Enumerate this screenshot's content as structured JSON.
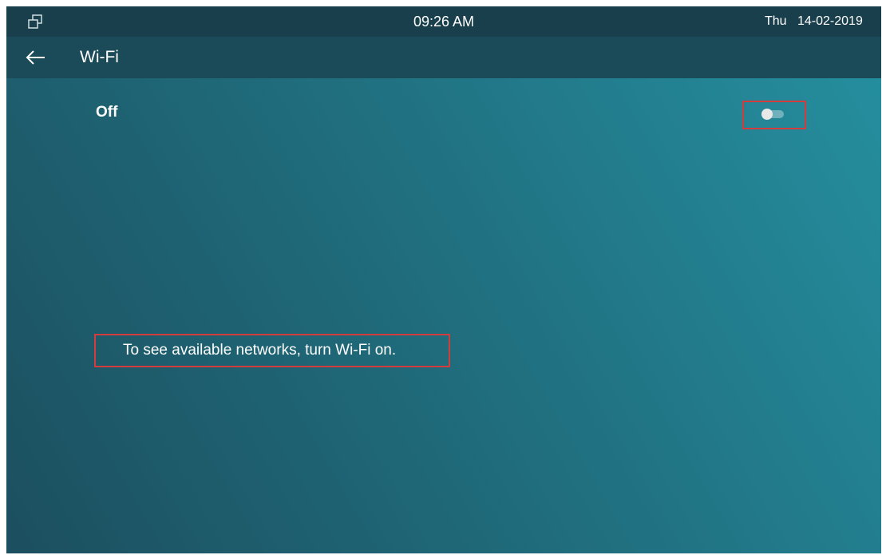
{
  "status_bar": {
    "window_icon": "window-restore-icon",
    "time": "09:26 AM",
    "day": "Thu",
    "date": "14-02-2019"
  },
  "title_bar": {
    "back_icon": "back-arrow-icon",
    "title": "Wi-Fi"
  },
  "wifi_toggle": {
    "label": "Off",
    "enabled": false
  },
  "message": "To see available networks, turn Wi-Fi on.",
  "colors": {
    "highlight": "#d23c3c",
    "status_bar": "#1a3f4c",
    "title_bar": "#1b4b58"
  }
}
